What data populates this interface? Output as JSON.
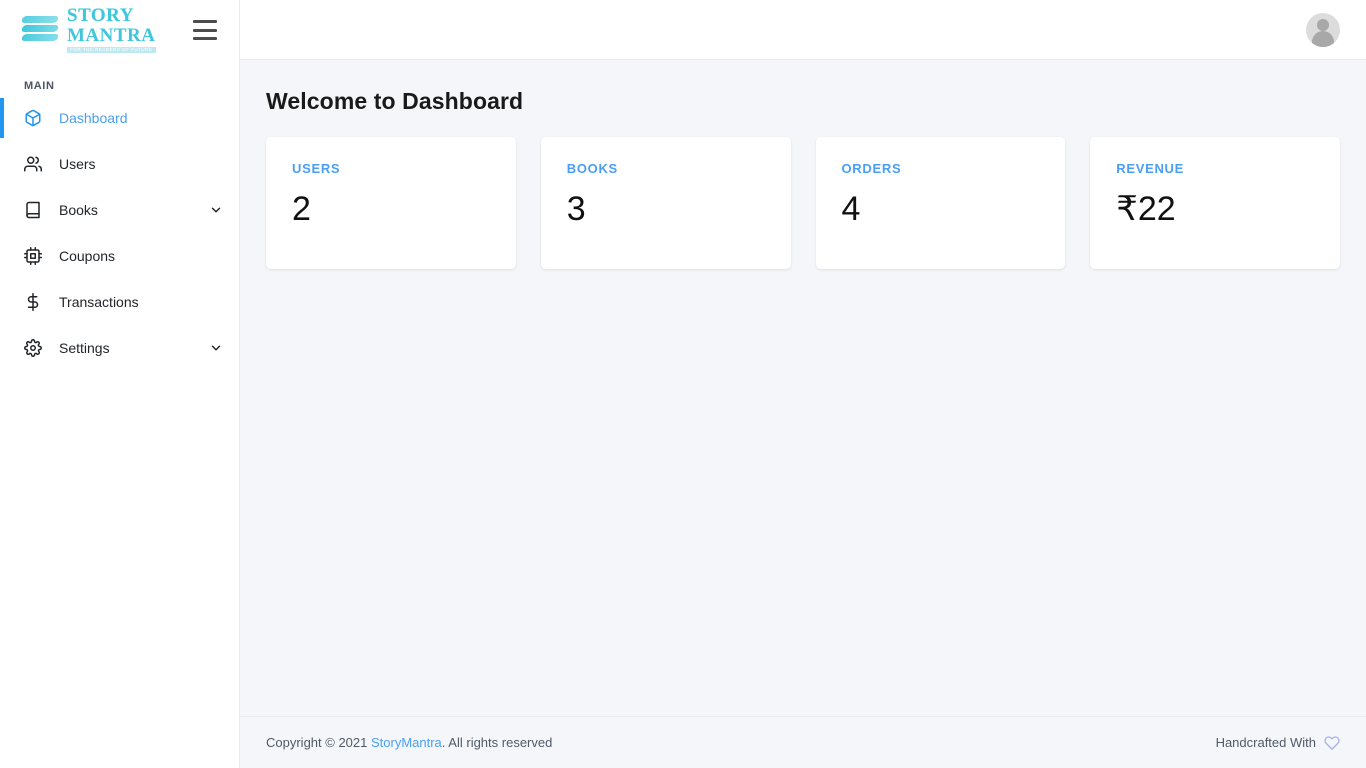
{
  "brand": {
    "name_line1": "STORY",
    "name_line2": "MANTRA",
    "tagline": "FOR THE READERS OF FUTURE",
    "logo_color": "#3fc6da"
  },
  "topbar": {
    "menu_toggle_label": "Toggle navigation",
    "avatar_label": "User profile"
  },
  "sidebar": {
    "section_label": "MAIN",
    "items": [
      {
        "label": "Dashboard",
        "icon": "cube-icon",
        "active": true,
        "chevron": false
      },
      {
        "label": "Users",
        "icon": "users-icon",
        "active": false,
        "chevron": false
      },
      {
        "label": "Books",
        "icon": "book-icon",
        "active": false,
        "chevron": true
      },
      {
        "label": "Coupons",
        "icon": "chip-icon",
        "active": false,
        "chevron": false
      },
      {
        "label": "Transactions",
        "icon": "dollar-sign-icon",
        "active": false,
        "chevron": false
      },
      {
        "label": "Settings",
        "icon": "gear-icon",
        "active": false,
        "chevron": true
      }
    ],
    "active_accent": "#2196f3"
  },
  "main": {
    "page_title": "Welcome to Dashboard",
    "cards": [
      {
        "label": "USERS",
        "value": "2"
      },
      {
        "label": "BOOKS",
        "value": "3"
      },
      {
        "label": "ORDERS",
        "value": "4"
      },
      {
        "label": "REVENUE",
        "value": "₹22"
      }
    ],
    "card_label_color": "#4a9ff5"
  },
  "footer": {
    "copyright_prefix": "Copyright © 2021 ",
    "brand_link": "StoryMantra",
    "copyright_suffix": ". All rights reserved",
    "handcrafted_text": "Handcrafted With",
    "heart_icon": "heart-icon",
    "heart_color": "#a9b0e8"
  }
}
